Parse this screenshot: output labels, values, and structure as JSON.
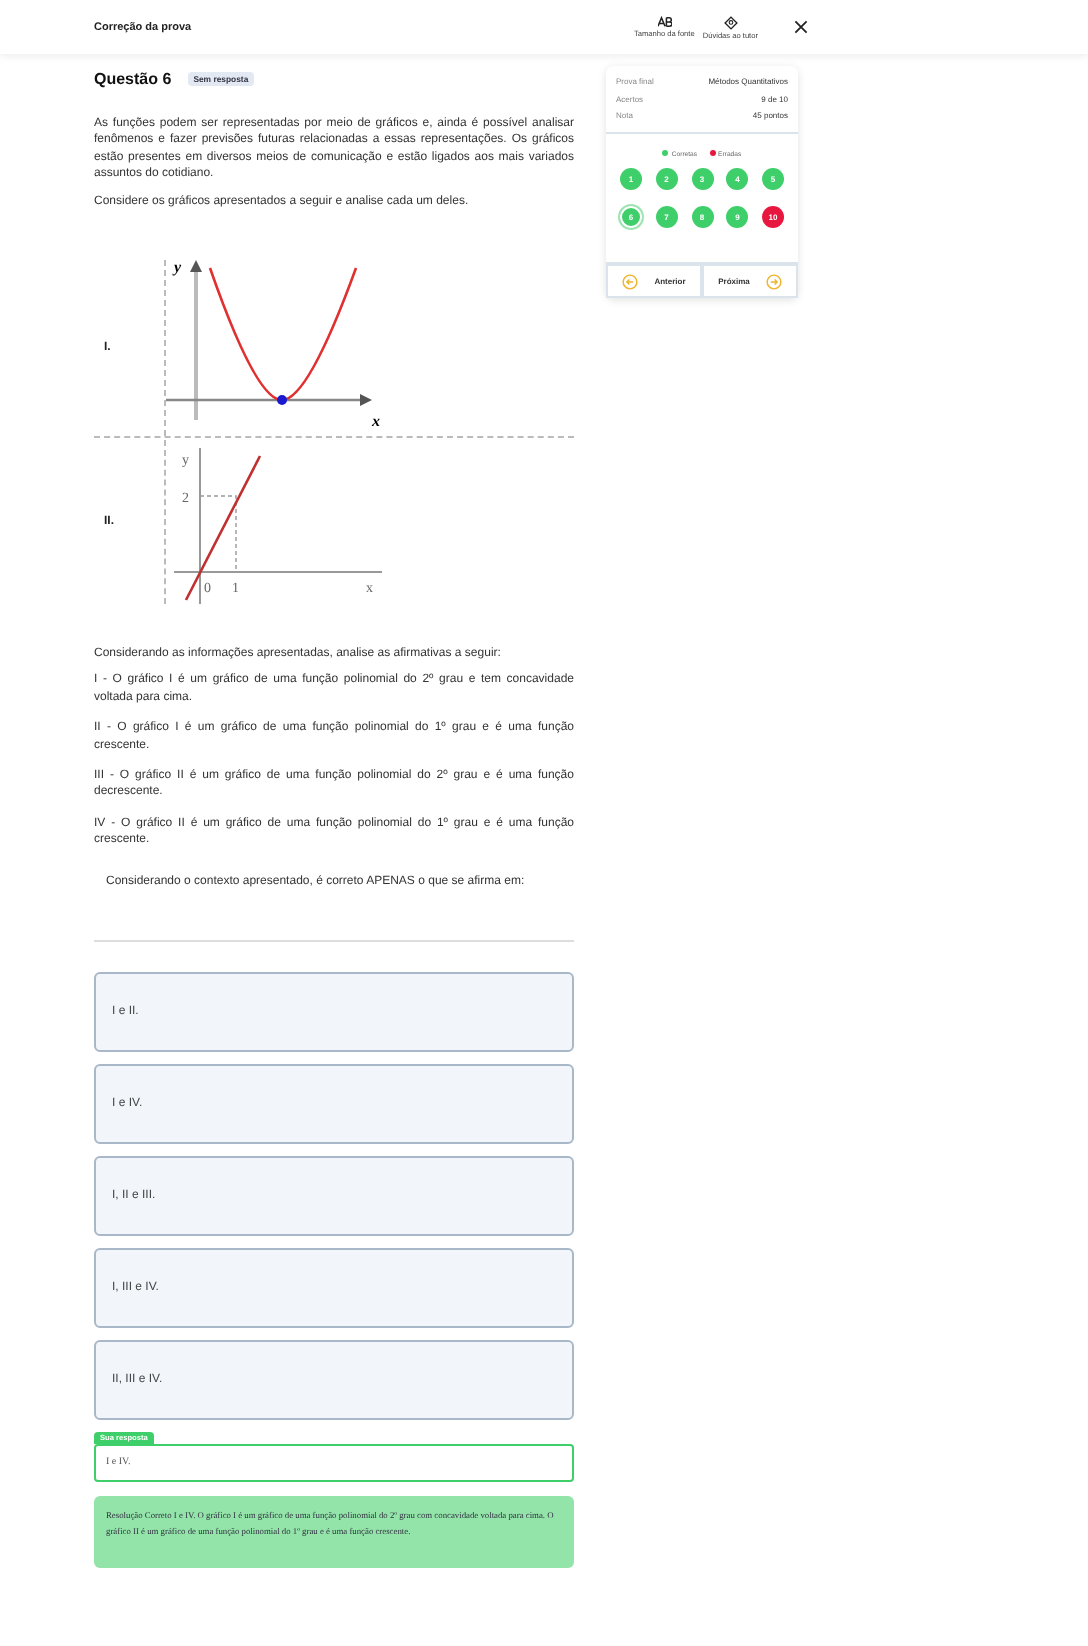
{
  "header": {
    "title": "Correção da prova",
    "tools": [
      {
        "kind": "font",
        "label": "Tamanho da fonte"
      },
      {
        "kind": "tutor",
        "label": "Dúvidas ao tutor"
      }
    ]
  },
  "question": {
    "title": "Questão 6",
    "badge": "Sem resposta",
    "paragraphs": [
      "As funções podem ser representadas por meio de gráficos e, ainda é possível analisar fenômenos e fazer previsões futuras relacionadas a essas representações. Os gráficos estão presentes em diversos meios de comunicação e estão ligados aos mais variados assuntos do cotidiano.",
      "Considere os gráficos apresentados a seguir e analise cada um deles."
    ],
    "graphs": [
      {
        "kind": "parabola",
        "label": "I.",
        "axis_labels": [
          "y",
          "x"
        ]
      },
      {
        "kind": "line",
        "label": "II.",
        "axis_labels": [
          "y",
          "2",
          "0",
          "1",
          "x"
        ]
      }
    ],
    "intro": "Considerando as informações apresentadas, analise as afirmativas a seguir:",
    "statements": [
      "I - O gráfico I é um gráfico de uma função polinomial do 2º grau e tem concavidade voltada para cima.",
      "II - O gráfico I é um gráfico de uma função polinomial do 1º grau e é uma função crescente.",
      "III - O gráfico II é um gráfico de uma função polinomial do 2º grau e é uma função decrescente.",
      "IV - O gráfico II é um gráfico de uma função polinomial do 1º grau e é uma função crescente."
    ],
    "prompt": "Considerando o contexto apresentado, é correto APENAS o que se afirma em:",
    "options": [
      "I e II.",
      "I e IV.",
      "I, II e III.",
      "I, III e IV.",
      "II, III e IV."
    ],
    "answer": {
      "tag": "Sua resposta",
      "value": "I e IV."
    },
    "resolution": "Resolução Correto I e IV. O gráfico I é um gráfico de uma função polinomial do 2º grau com concavidade voltada para cima. O gráfico II é um gráfico de uma função polinomial do 1º grau e é uma função crescente."
  },
  "summary": {
    "rows": [
      {
        "label": "Prova final",
        "value": "Métodos Quantitativos"
      },
      {
        "label": "Acertos",
        "value": "9 de 10"
      },
      {
        "label": "Nota",
        "value": "45 pontos"
      }
    ],
    "legend": [
      {
        "label": "Corretas",
        "color": "#3fcf6a"
      },
      {
        "label": "Erradas",
        "color": "#e8173f"
      }
    ],
    "questions": [
      {
        "number": "1",
        "correct": true,
        "selected": false
      },
      {
        "number": "2",
        "correct": true,
        "selected": false
      },
      {
        "number": "3",
        "correct": true,
        "selected": false
      },
      {
        "number": "4",
        "correct": true,
        "selected": false
      },
      {
        "number": "5",
        "correct": true,
        "selected": false
      },
      {
        "number": "6",
        "correct": true,
        "selected": true
      },
      {
        "number": "7",
        "correct": true,
        "selected": false
      },
      {
        "number": "8",
        "correct": true,
        "selected": false
      },
      {
        "number": "9",
        "correct": true,
        "selected": false
      },
      {
        "number": "10",
        "correct": false,
        "selected": false
      }
    ],
    "nav": [
      {
        "kind": "prev",
        "label": "Anterior"
      },
      {
        "kind": "next",
        "label": "Próxima"
      }
    ]
  }
}
